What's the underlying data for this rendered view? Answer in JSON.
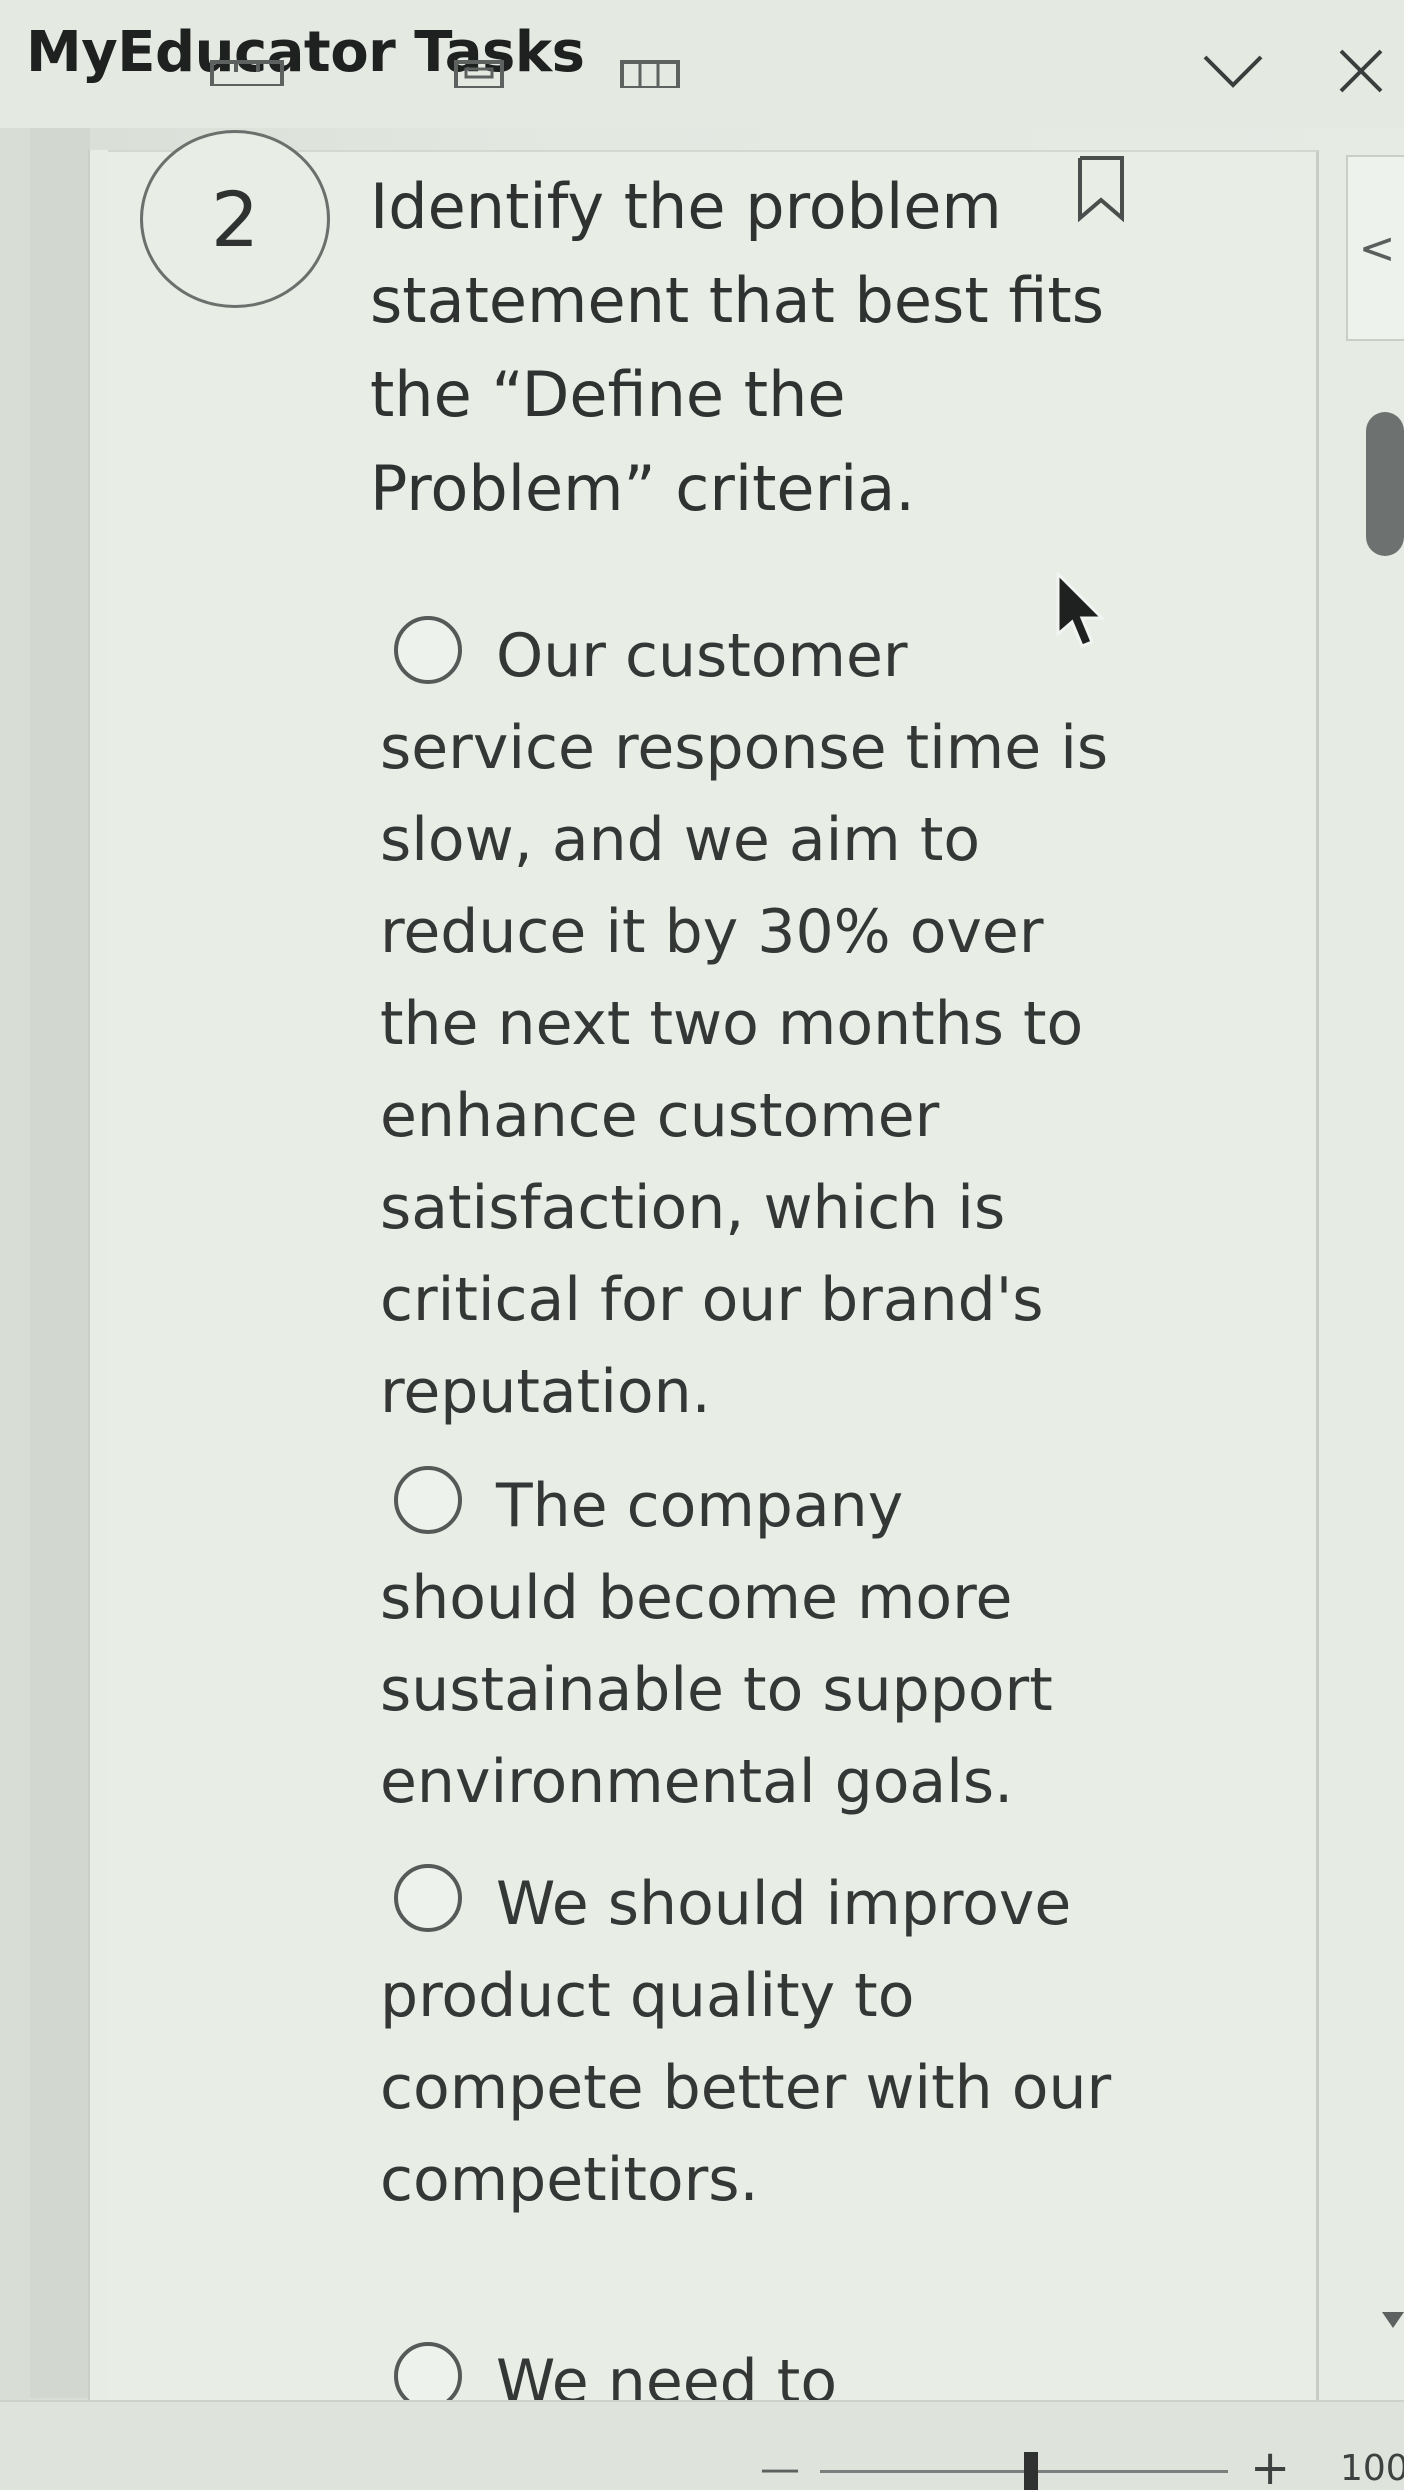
{
  "app": {
    "title": "MyEducator Tasks"
  },
  "question": {
    "number": "2",
    "text": "Identify the problem statement that best fits the “Define the Problem” criteria."
  },
  "options": [
    {
      "text": "Our customer service response time is slow, and we aim to reduce it by 30% over the next two months to enhance customer satisfaction, which is critical for our brand's reputation."
    },
    {
      "text": "The company should become more sustainable to support environmental goals."
    },
    {
      "text": "We should improve product quality to compete better with our competitors."
    },
    {
      "text": "We need to"
    }
  ],
  "side_tab": {
    "label": "<"
  },
  "statusbar": {
    "zoom_minus": "—",
    "zoom_plus": "+",
    "zoom_level": "100"
  },
  "icons": {
    "collapse": "chevron-down-icon",
    "close": "close-icon",
    "bookmark": "bookmark-icon"
  }
}
